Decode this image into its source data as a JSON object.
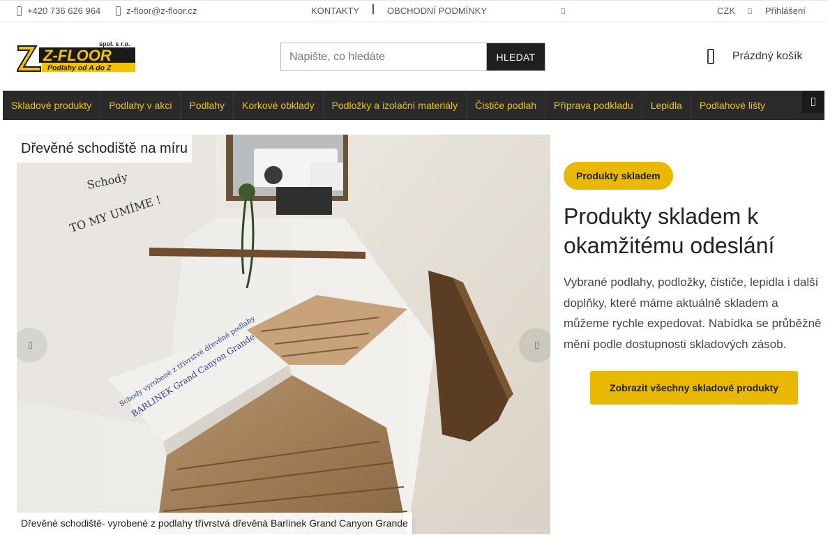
{
  "topbar": {
    "phone": "+420 736 626 964",
    "email": "z-floor@z-floor.cz",
    "contacts_link": "KONTAKTY",
    "terms_link": "OBCHODNÍ PODMÍNKY",
    "currency": "CZK",
    "login": "Přihlášení"
  },
  "logo": {
    "brand": "Z-FLOOR",
    "company_suffix": "spol. s r.o.",
    "tagline": "Podlahy od A do Z"
  },
  "search": {
    "placeholder": "Napište, co hledáte",
    "button_label": "HLEDAT"
  },
  "cart": {
    "label": "Prázdný košík"
  },
  "nav": {
    "items": [
      "Skladové produkty",
      "Podlahy v akci",
      "Podlahy",
      "Korkové obklady",
      "Podložky a izolační materiály",
      "Čističe podlah",
      "Příprava podkladu",
      "Lepidla",
      "Podlahové lišty"
    ]
  },
  "hero": {
    "title": "Dřevěné schodiště na míru",
    "caption": "Dřevěné schodiště- vyrobené z podlahy třívrstvá dřevěná Barlínek Grand Canyon Grande",
    "wall_text_1": "Schody",
    "wall_text_2": "TO MY UMÍME !",
    "bench_text_1": "Schody vyrobené z třívrstvé dřevěné podlahy",
    "bench_text_2": "BARLINEK Grand Canyon Grande"
  },
  "promo": {
    "badge": "Produkty skladem",
    "heading": "Produkty skladem k okamžitému odeslání",
    "text": "Vybrané podlahy, podložky, čističe, lepidla i další doplňky, které máme aktuálně skladem a můžeme rychle expedovat. Nabídka se průběžně mění podle dostupnosti skladových zásob.",
    "cta": "Zobrazit všechny skladové produkty"
  },
  "colors": {
    "accent": "#e9b800",
    "nav_bg": "#2a2a2a",
    "nav_text": "#f2c300",
    "dark_button": "#1f1f1f"
  },
  "icons": {
    "phone": "phone-icon",
    "email": "mail-icon",
    "cart": "cart-icon",
    "prev": "chevron-left-icon",
    "next": "chevron-right-icon"
  }
}
